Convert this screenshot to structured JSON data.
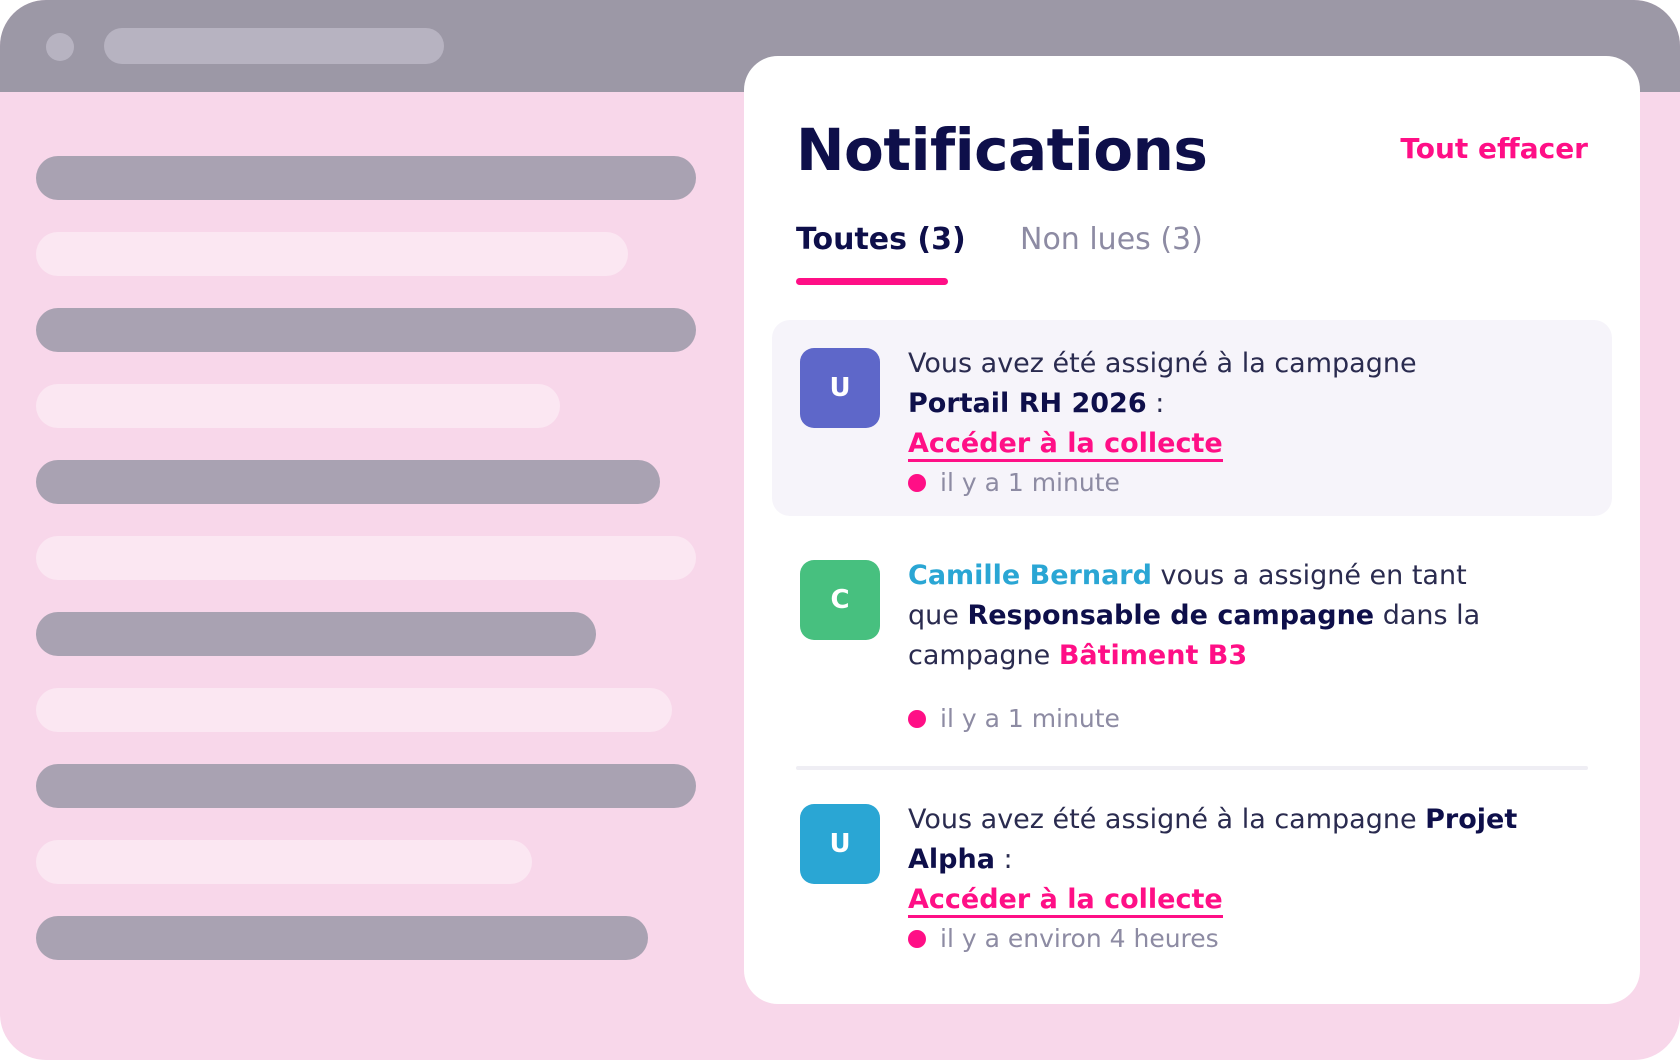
{
  "colors": {
    "accent": "#ff0f86",
    "title": "#0e0f4a",
    "muted": "#8d8ba3",
    "person": "#2aa6d4",
    "avatar_purple": "#5e67c9",
    "avatar_green": "#47c07f",
    "avatar_blue": "#2aa6d4"
  },
  "panel": {
    "title": "Notifications",
    "clear_all": "Tout effacer",
    "tabs": [
      {
        "label": "Toutes (3)",
        "active": true
      },
      {
        "label": "Non lues (3)",
        "active": false
      }
    ]
  },
  "notifications": [
    {
      "avatar": "U",
      "text_before": "Vous avez été assigné à la campagne ",
      "campaign": "Portail RH 2026",
      "text_after": " :",
      "link": "Accéder à la collecte",
      "time": "il y a 1 minute",
      "unread": true
    },
    {
      "avatar": "C",
      "person": "Camille Bernard",
      "text_1": " vous a assigné en tant que ",
      "role": "Responsable de campagne",
      "text_2": " dans la campagne ",
      "campaign": "Bâtiment B3",
      "time": "il y a 1 minute",
      "unread": true
    },
    {
      "avatar": "U",
      "text_before": "Vous avez été assigné à la campagne ",
      "campaign": "Projet Alpha",
      "text_after": " :",
      "link": "Accéder à la collecte",
      "time": "il y a environ 4 heures",
      "unread": true
    }
  ]
}
